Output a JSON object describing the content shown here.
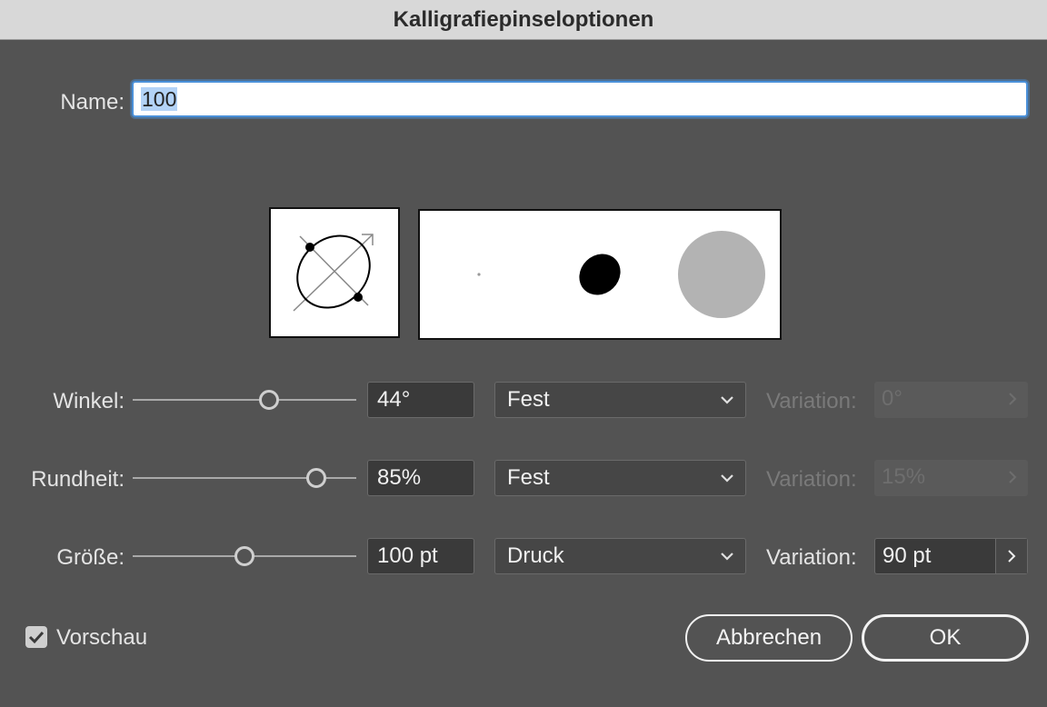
{
  "window": {
    "title": "Kalligrafiepinseloptionen"
  },
  "name_field": {
    "label": "Name:",
    "value": "100"
  },
  "rows": [
    {
      "label": "Winkel:",
      "slider_fraction": 0.61,
      "value": "44°",
      "mode": "Fest",
      "variation_label": "Variation:",
      "variation_value": "0°",
      "variation_enabled": false
    },
    {
      "label": "Rundheit:",
      "slider_fraction": 0.82,
      "value": "85%",
      "mode": "Fest",
      "variation_label": "Variation:",
      "variation_value": "15%",
      "variation_enabled": false
    },
    {
      "label": "Größe:",
      "slider_fraction": 0.5,
      "value": "100 pt",
      "mode": "Druck",
      "variation_label": "Variation:",
      "variation_value": "90 pt",
      "variation_enabled": true
    }
  ],
  "icons": {
    "dropdown": "chevron-down-icon",
    "stepper": "chevron-right-icon",
    "check": "checkmark-icon"
  },
  "preview": {
    "checkbox_label": "Vorschau",
    "checked": true
  },
  "buttons": {
    "cancel": "Abbrechen",
    "ok": "OK"
  },
  "colors": {
    "background": "#535353",
    "focus_ring": "#4a90d9",
    "preview_dot": "#000000",
    "preview_max": "#b3b3b3"
  }
}
